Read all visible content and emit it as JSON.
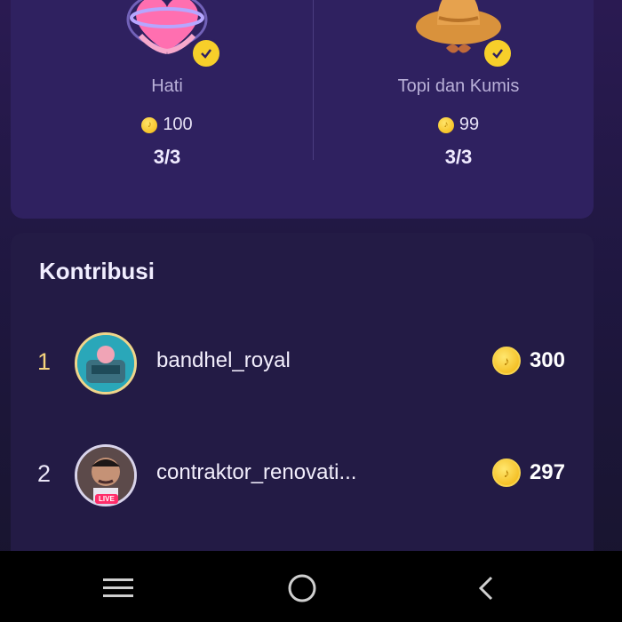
{
  "gifts": [
    {
      "name": "Hati",
      "price": "100",
      "count": "3/3",
      "icon": "heart-gift-icon"
    },
    {
      "name": "Topi dan Kumis",
      "price": "99",
      "count": "3/3",
      "icon": "hat-mustache-gift-icon"
    }
  ],
  "contributions": {
    "title": "Kontribusi",
    "rows": [
      {
        "rank": "1",
        "username": "bandhel_royal",
        "score": "300"
      },
      {
        "rank": "2",
        "username": "contraktor_renovati...",
        "score": "297",
        "badge": "LIVE"
      }
    ]
  },
  "colors": {
    "accent_gold": "#f7cf2a",
    "card_top": "#2f2160",
    "card_bottom": "#231b45"
  },
  "navbar": {
    "icons": [
      "menu-icon",
      "home-circle-icon",
      "back-icon"
    ]
  }
}
